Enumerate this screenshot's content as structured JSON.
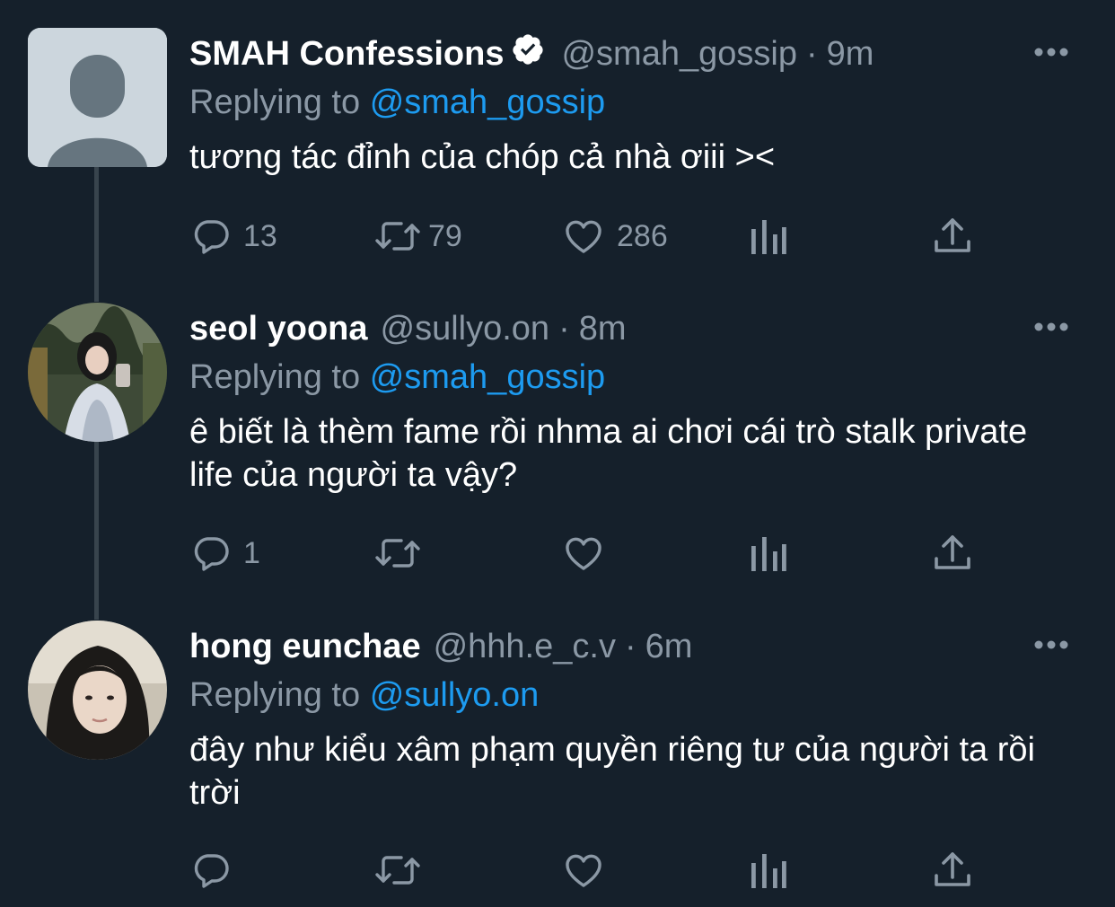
{
  "tweets": [
    {
      "display_name": "SMAH Confessions",
      "verified": true,
      "handle": "@smah_gossip",
      "dot": "·",
      "time": "9m",
      "replying_prefix": "Replying to",
      "replying_to": "@smah_gossip",
      "text": "tương tác đỉnh của chóp cả nhà ơiii ><",
      "replies": "13",
      "retweets": "79",
      "likes": "286"
    },
    {
      "display_name": "seol yoona",
      "verified": false,
      "handle": "@sullyo.on",
      "dot": "·",
      "time": "8m",
      "replying_prefix": "Replying to",
      "replying_to": "@smah_gossip",
      "text": "ê biết là thèm fame rồi nhma ai chơi cái trò stalk private life của người ta vậy?",
      "replies": "1",
      "retweets": "",
      "likes": ""
    },
    {
      "display_name": "hong eunchae",
      "verified": false,
      "handle": "@hhh.e_c.v",
      "dot": "·",
      "time": "6m",
      "replying_prefix": "Replying to",
      "replying_to": "@sullyo.on",
      "text": "đây như kiểu xâm phạm quyền riêng tư của người ta rồi trời",
      "replies": "",
      "retweets": "",
      "likes": ""
    }
  ],
  "icons": {
    "more": "more-horizontal-icon",
    "verified": "verified-badge-icon",
    "reply": "reply-icon",
    "retweet": "retweet-icon",
    "like": "heart-icon",
    "views": "analytics-icon",
    "share": "share-icon"
  },
  "colors": {
    "background": "#15202b",
    "text": "#ffffff",
    "muted": "#8b98a5",
    "link": "#1d9bf0",
    "thread_line": "#38444d"
  }
}
